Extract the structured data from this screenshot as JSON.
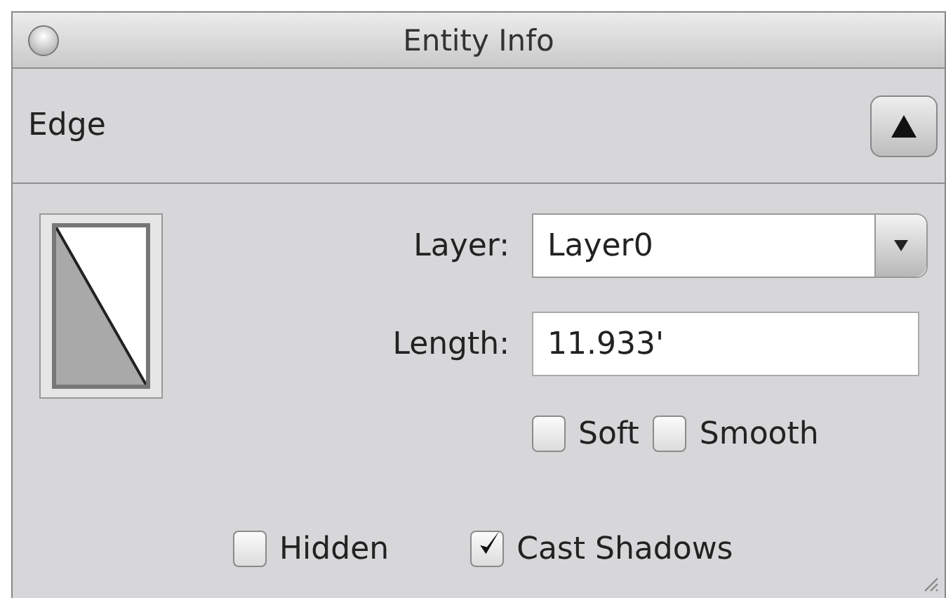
{
  "window": {
    "title": "Entity Info"
  },
  "header": {
    "entity_type": "Edge"
  },
  "layer": {
    "label": "Layer:",
    "value": "Layer0"
  },
  "length": {
    "label": "Length:",
    "value": "11.933'"
  },
  "options": [
    {
      "label": "Soft",
      "checked": false
    },
    {
      "label": "Smooth",
      "checked": false
    }
  ],
  "flags": [
    {
      "label": "Hidden",
      "checked": false
    },
    {
      "label": "Cast Shadows",
      "checked": true
    }
  ]
}
